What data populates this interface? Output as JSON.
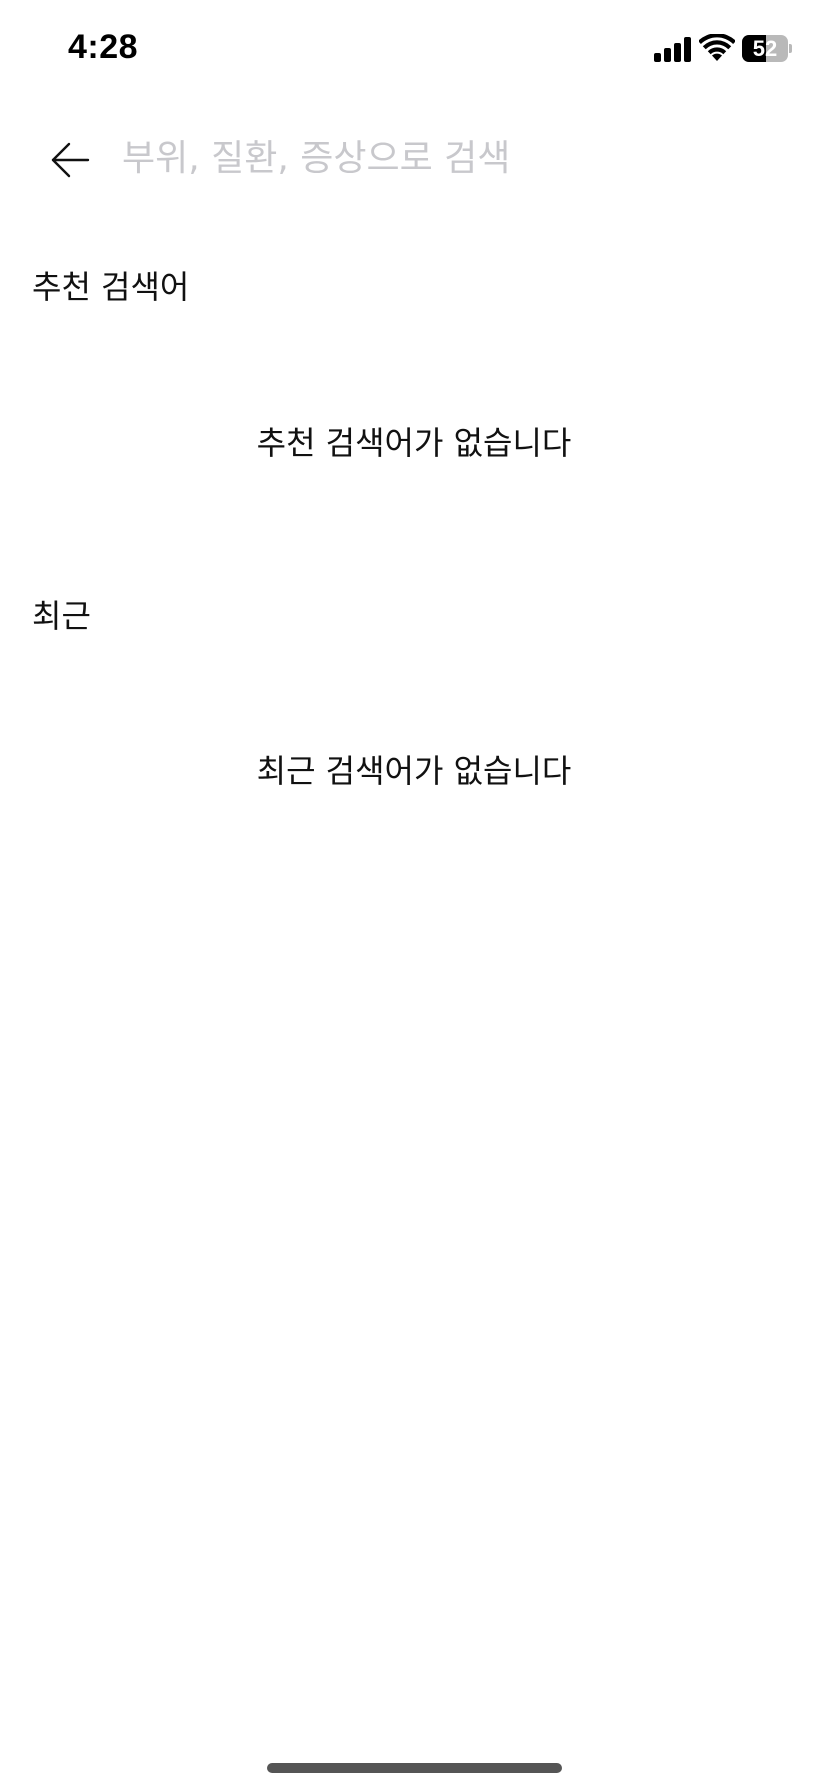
{
  "status_bar": {
    "time": "4:28",
    "battery_level": "52",
    "battery_percent": 52
  },
  "search": {
    "placeholder": "부위, 질환, 증상으로 검색",
    "value": ""
  },
  "recommended": {
    "title": "추천 검색어",
    "empty_message": "추천 검색어가 없습니다"
  },
  "recent": {
    "title": "최근",
    "empty_message": "최근 검색어가 없습니다"
  },
  "icons": {
    "back": "arrow-left-icon",
    "signal": "cellular-signal-icon",
    "wifi": "wifi-icon",
    "battery": "battery-icon"
  }
}
